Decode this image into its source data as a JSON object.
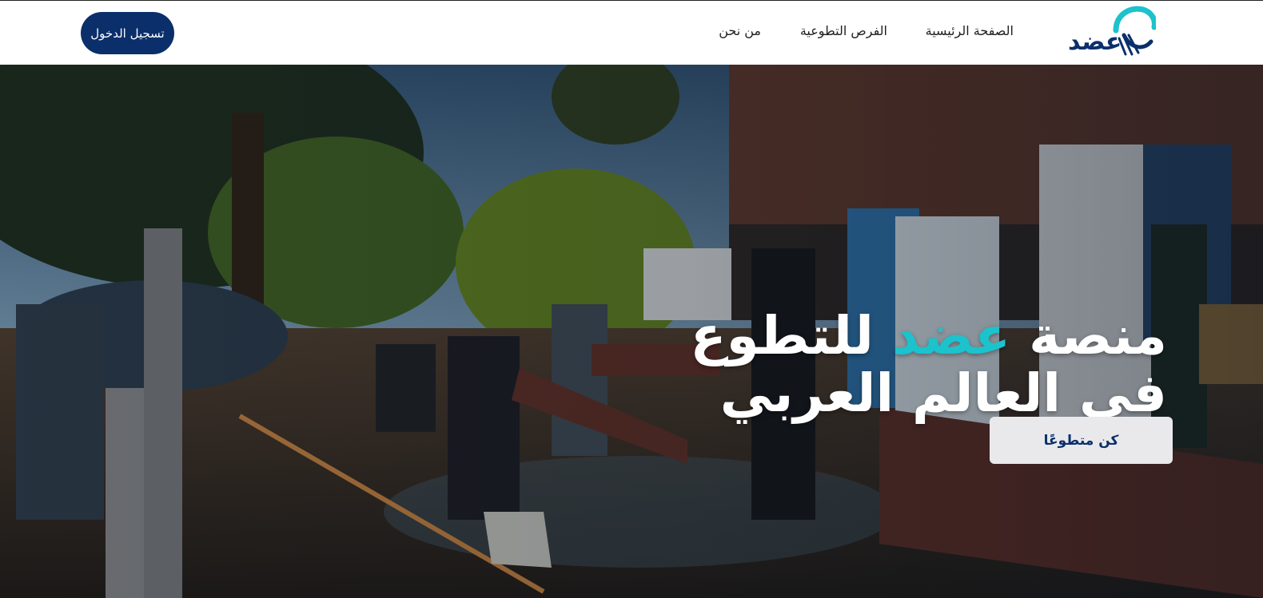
{
  "nav": {
    "login_label": "تسجيل الدخول",
    "links": [
      "الصفحة الرئيسية",
      "الفرص التطوعية",
      "من نحن"
    ],
    "logo_text": "عضد"
  },
  "hero": {
    "headline_prefix": "منصة",
    "headline_accent": "عضد",
    "headline_suffix": "للتطوع",
    "headline_line2": "في العالم العربي",
    "cta_label": "كن متطوعًا"
  },
  "colors": {
    "brand_navy": "#0b2f6b",
    "brand_teal": "#1cc2cc",
    "cta_bg": "#e9e9ec"
  }
}
